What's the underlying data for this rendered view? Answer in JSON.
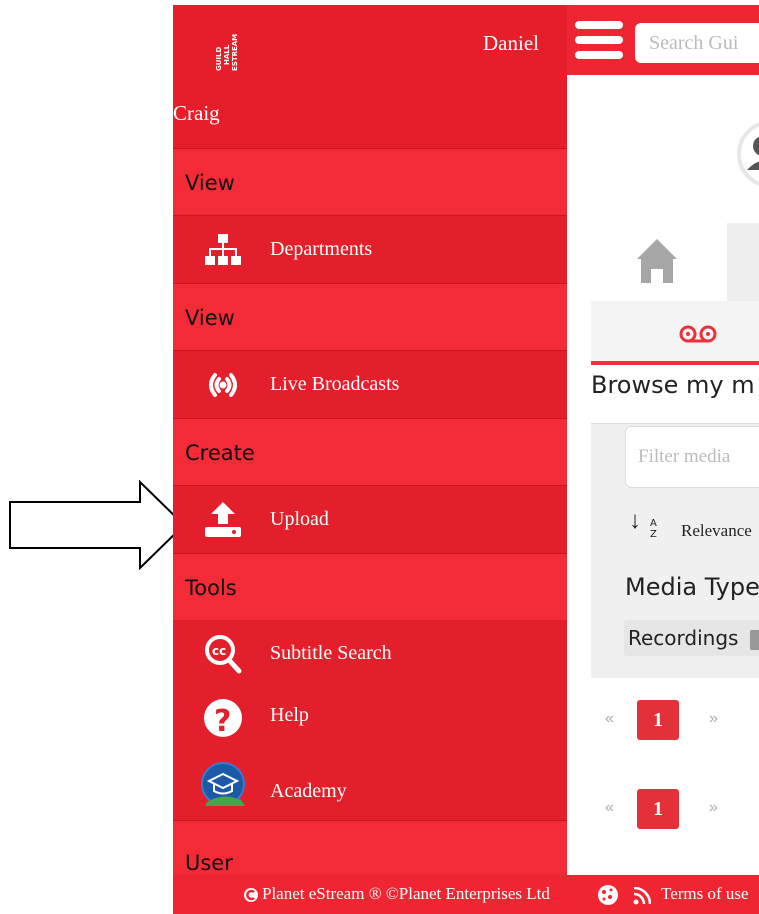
{
  "sidebar": {
    "user_first": "Daniel",
    "user_last": "Craig",
    "logo_text": "GUILDHALL eSTREAM",
    "sections": [
      {
        "label": "View",
        "items": [
          {
            "label": "Departments",
            "icon": "sitemap-icon"
          }
        ]
      },
      {
        "label": "View",
        "items": [
          {
            "label": "Live Broadcasts",
            "icon": "broadcast-icon"
          }
        ]
      },
      {
        "label": "Create",
        "items": [
          {
            "label": "Upload",
            "icon": "upload-icon"
          }
        ]
      },
      {
        "label": "Tools",
        "items": [
          {
            "label": "Subtitle Search",
            "icon": "cc-search-icon"
          },
          {
            "label": "Help",
            "icon": "help-icon"
          },
          {
            "label": "Academy",
            "icon": "academy-icon"
          }
        ]
      },
      {
        "label": "User",
        "items": []
      }
    ]
  },
  "content": {
    "search_placeholder": "Search Gui",
    "browse_title": "Browse my m",
    "filter_placeholder": "Filter media",
    "sort_label": "Relevance",
    "sort_icon": "sort-az-icon",
    "media_type_heading": "Media Type",
    "recordings_label": "Recordings",
    "pager": {
      "prev": "«",
      "current": "1",
      "next": "»"
    }
  },
  "footer": {
    "copyright": "Planet eStream ® ©Planet Enterprises Ltd",
    "terms": "Terms of use"
  },
  "colors": {
    "brand_red": "#e21f2b",
    "section_red": "#f22b36"
  }
}
